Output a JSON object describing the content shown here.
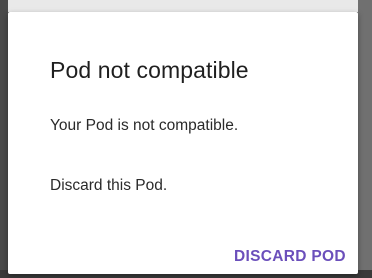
{
  "dialog": {
    "title": "Pod not compatible",
    "message_line1": "Your Pod is not compatible.",
    "message_line2": "Discard this Pod.",
    "action_label": "DISCARD POD"
  },
  "colors": {
    "accent": "#6b4fbb",
    "dialog_background": "#ffffff",
    "scrim": "#595959"
  }
}
